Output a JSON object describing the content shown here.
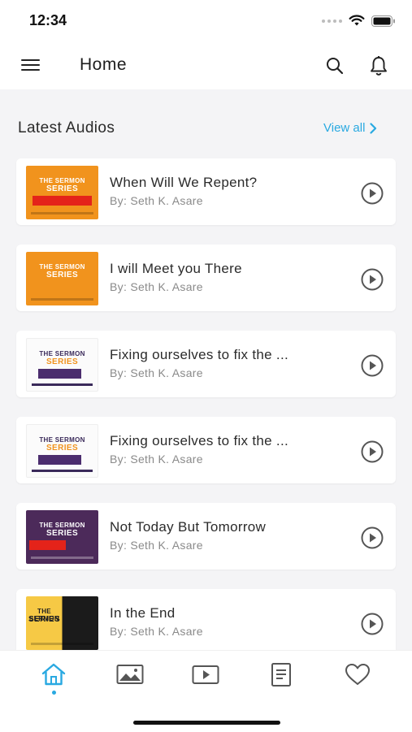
{
  "status_bar": {
    "time": "12:34"
  },
  "header": {
    "title": "Home",
    "menu_icon": "menu-icon",
    "search_icon": "search-icon",
    "bell_icon": "bell-icon"
  },
  "section": {
    "title": "Latest Audios",
    "view_all_label": "View all"
  },
  "audios": [
    {
      "title": "When Will We Repent?",
      "author": "By: Seth K. Asare",
      "thumb_style": "orange",
      "thumb_line1": "THE SERMON",
      "thumb_line2": "SERIES"
    },
    {
      "title": "I will Meet you There",
      "author": "By: Seth K. Asare",
      "thumb_style": "orange",
      "thumb_line1": "THE SERMON",
      "thumb_line2": "SERIES"
    },
    {
      "title": "Fixing ourselves to fix the ...",
      "author": "By: Seth K. Asare",
      "thumb_style": "white",
      "thumb_line1": "THE SERMON",
      "thumb_line2": "SERIES"
    },
    {
      "title": "Fixing ourselves to fix the ...",
      "author": "By: Seth K. Asare",
      "thumb_style": "white",
      "thumb_line1": "THE SERMON",
      "thumb_line2": "SERIES"
    },
    {
      "title": "Not Today But Tomorrow",
      "author": "By: Seth K. Asare",
      "thumb_style": "purple",
      "thumb_line1": "THE SERMON",
      "thumb_line2": "SERIES"
    },
    {
      "title": "In the End",
      "author": "By: Seth K. Asare",
      "thumb_style": "split",
      "thumb_line1": "THE SERMON",
      "thumb_line2": "SERIES"
    }
  ],
  "bottom_nav": [
    {
      "name": "home",
      "icon": "home-icon",
      "active": true
    },
    {
      "name": "gallery",
      "icon": "image-icon",
      "active": false
    },
    {
      "name": "videos",
      "icon": "video-icon",
      "active": false
    },
    {
      "name": "articles",
      "icon": "document-icon",
      "active": false
    },
    {
      "name": "favorites",
      "icon": "heart-icon",
      "active": false
    }
  ],
  "colors": {
    "accent": "#29a9e1",
    "background": "#f4f4f6",
    "card": "#ffffff"
  }
}
